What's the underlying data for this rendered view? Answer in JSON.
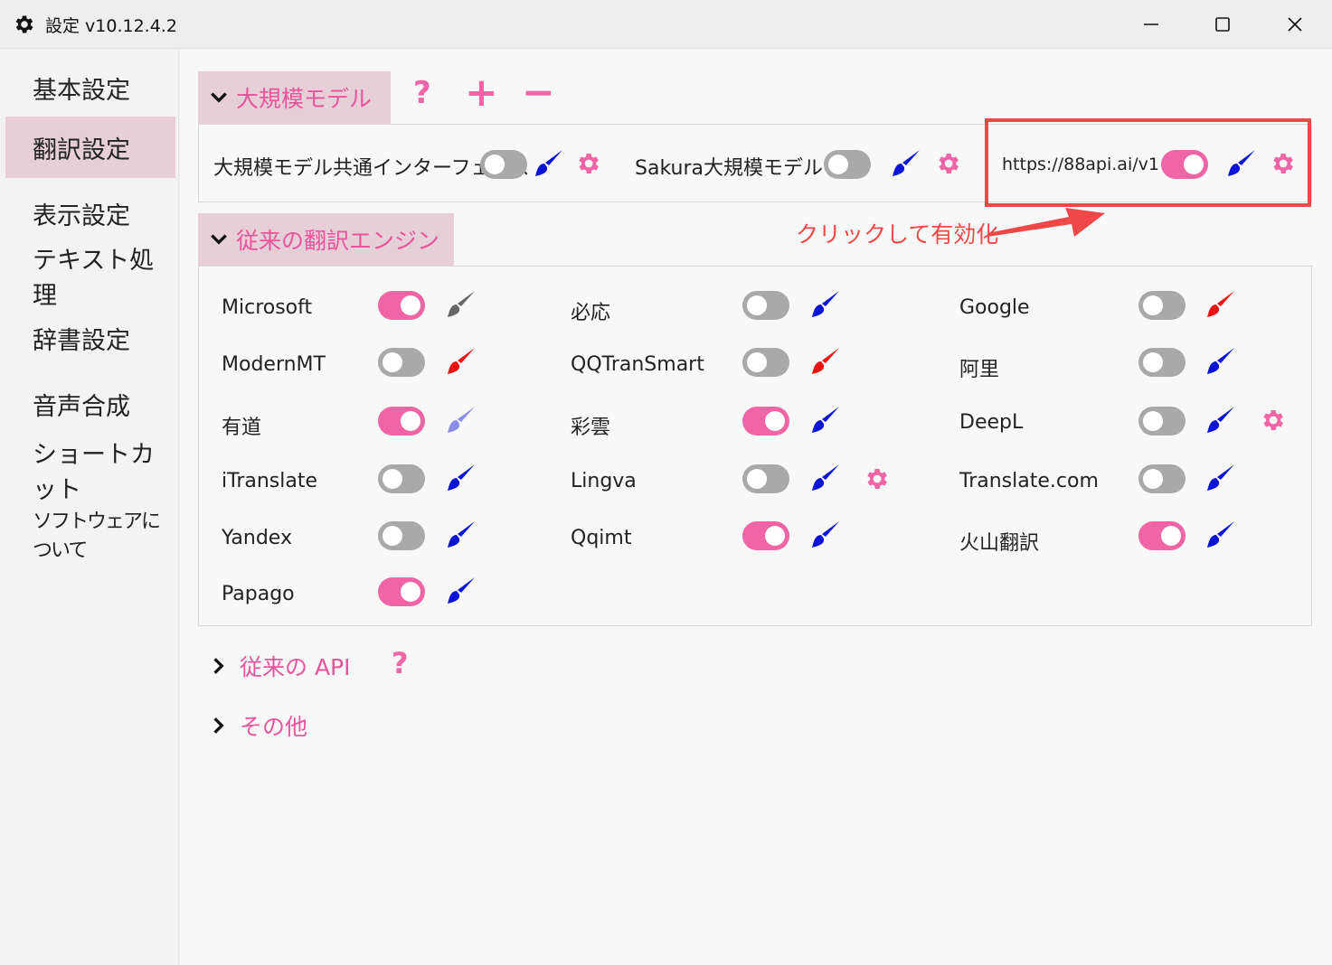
{
  "window": {
    "title": "設定 v10.12.4.2"
  },
  "sidebar": {
    "items": [
      {
        "label": "基本設定"
      },
      {
        "label": "翻訳設定"
      },
      {
        "label": "表示設定"
      },
      {
        "label": "テキスト処理"
      },
      {
        "label": "辞書設定"
      },
      {
        "label": "音声合成"
      },
      {
        "label": "ショートカット"
      },
      {
        "label": "ソフトウェアについて"
      }
    ],
    "active_index": 1
  },
  "llm_section": {
    "title": "大規模モデル",
    "help_icon": "?",
    "add_icon": "+",
    "remove_icon": "−",
    "items": [
      {
        "label": "大規模モデル共通インターフェース",
        "enabled": false,
        "brush_color": "#0a14d6"
      },
      {
        "label": "Sakura大規模モデル",
        "enabled": false,
        "brush_color": "#0a14d6"
      },
      {
        "label": "https://88api.ai/v1",
        "enabled": true,
        "brush_color": "#0a14d6"
      }
    ]
  },
  "annotation": {
    "text": "クリックして有効化",
    "color": "#f04848"
  },
  "engines_section": {
    "title": "従来の翻訳エンジン",
    "columns": [
      [
        {
          "label": "Microsoft",
          "enabled": true,
          "brush_color": "#666666"
        },
        {
          "label": "ModernMT",
          "enabled": false,
          "brush_color": "#ee1111"
        },
        {
          "label": "有道",
          "enabled": true,
          "brush_color": "#8a8ee8"
        },
        {
          "label": "iTranslate",
          "enabled": false,
          "brush_color": "#0a14d6"
        },
        {
          "label": "Yandex",
          "enabled": false,
          "brush_color": "#0a14d6"
        },
        {
          "label": "Papago",
          "enabled": true,
          "brush_color": "#0a14d6"
        }
      ],
      [
        {
          "label": "必応",
          "enabled": false,
          "brush_color": "#0a14d6"
        },
        {
          "label": "QQTranSmart",
          "enabled": false,
          "brush_color": "#ee1111"
        },
        {
          "label": "彩雲",
          "enabled": true,
          "brush_color": "#0a14d6"
        },
        {
          "label": "Lingva",
          "enabled": false,
          "brush_color": "#0a14d6",
          "gear": true
        },
        {
          "label": "Qqimt",
          "enabled": true,
          "brush_color": "#0a14d6"
        }
      ],
      [
        {
          "label": "Google",
          "enabled": false,
          "brush_color": "#ee1111"
        },
        {
          "label": "阿里",
          "enabled": false,
          "brush_color": "#0a14d6"
        },
        {
          "label": "DeepL",
          "enabled": false,
          "brush_color": "#0a14d6",
          "gear": true
        },
        {
          "label": "Translate.com",
          "enabled": false,
          "brush_color": "#0a14d6"
        },
        {
          "label": "火山翻訳",
          "enabled": true,
          "brush_color": "#0a14d6"
        }
      ]
    ]
  },
  "api_section": {
    "title": "従来の API",
    "help_icon": "?"
  },
  "other_section": {
    "title": "その他"
  },
  "colors": {
    "accent": "#f065a5",
    "header_bg": "#e6cfd6",
    "toggle_off": "#a9a9a9"
  },
  "icons": {
    "app": "gear-icon",
    "settings": "gear-icon",
    "brush": "brush-icon",
    "minimize": "minimize-icon",
    "maximize": "maximize-icon",
    "close": "close-icon"
  }
}
